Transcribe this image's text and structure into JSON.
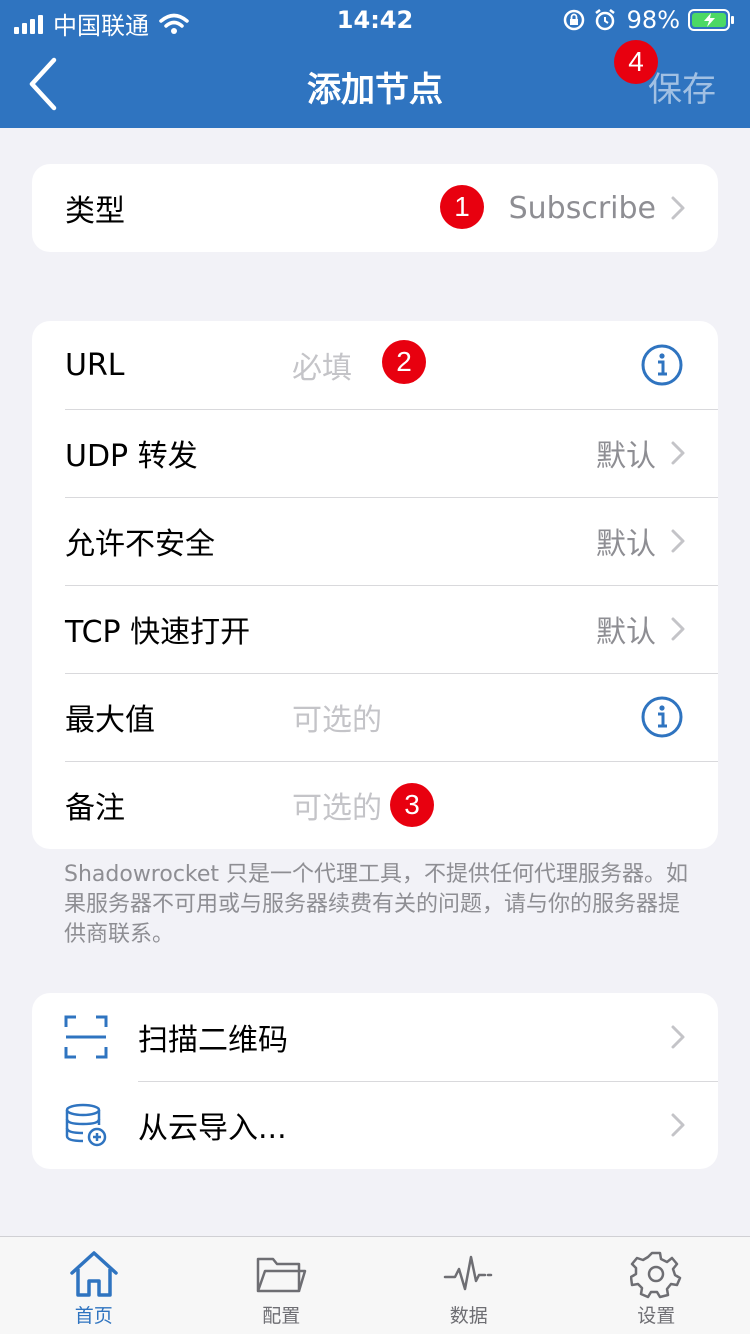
{
  "status_bar": {
    "carrier": "中国联通",
    "time": "14:42",
    "battery": "98%"
  },
  "nav": {
    "title": "添加节点",
    "save_label": "保存"
  },
  "badges": [
    "1",
    "2",
    "3",
    "4"
  ],
  "type_row": {
    "label": "类型",
    "value": "Subscribe"
  },
  "form": {
    "url": {
      "label": "URL",
      "placeholder": "必填"
    },
    "udp": {
      "label": "UDP 转发",
      "value": "默认"
    },
    "insecure": {
      "label": "允许不安全",
      "value": "默认"
    },
    "tfo": {
      "label": "TCP 快速打开",
      "value": "默认"
    },
    "max": {
      "label": "最大值",
      "placeholder": "可选的"
    },
    "remark": {
      "label": "备注",
      "placeholder": "可选的"
    }
  },
  "note": "Shadowrocket 只是一个代理工具，不提供任何代理服务器。如果服务器不可用或与服务器续费有关的问题，请与你的服务器提供商联系。",
  "actions": {
    "scan": "扫描二维码",
    "cloud": "从云导入..."
  },
  "tabs": [
    {
      "label": "首页",
      "icon": "home-icon",
      "active": true
    },
    {
      "label": "配置",
      "icon": "folder-icon",
      "active": false
    },
    {
      "label": "数据",
      "icon": "activity-icon",
      "active": false
    },
    {
      "label": "设置",
      "icon": "gear-icon",
      "active": false
    }
  ],
  "colors": {
    "accent": "#2f74c0",
    "badge": "#e8000f",
    "background": "#f2f2f7"
  }
}
